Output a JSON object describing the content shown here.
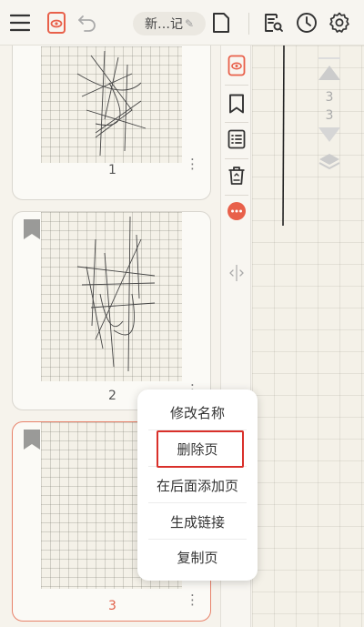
{
  "toolbar": {
    "menu_icon": "hamburger-icon",
    "notebook_icon": "notebook-eye-icon",
    "undo_icon": "undo-icon",
    "title": "新…记",
    "edit_icon": "pencil-icon",
    "page_icon": "page-icon",
    "search_icon": "document-search-icon",
    "history_icon": "clock-icon",
    "settings_icon": "gear-icon"
  },
  "thumbnails": [
    {
      "page_number": "1",
      "bookmarked": false,
      "selected": false
    },
    {
      "page_number": "2",
      "bookmarked": true,
      "selected": false
    },
    {
      "page_number": "3",
      "bookmarked": true,
      "selected": true
    }
  ],
  "side_tools": [
    "eye-notebook-icon",
    "bookmark-icon",
    "outline-list-icon",
    "recycle-bin-icon",
    "more-icon",
    "split-handle-icon"
  ],
  "page_nav": {
    "current": "3",
    "total": "3"
  },
  "context_menu": {
    "items": [
      "修改名称",
      "删除页",
      "在后面添加页",
      "生成链接",
      "复制页"
    ],
    "highlighted_index": 1
  },
  "colors": {
    "accent": "#e8604a",
    "highlight": "#d9302a",
    "background": "#f6f3ec"
  }
}
